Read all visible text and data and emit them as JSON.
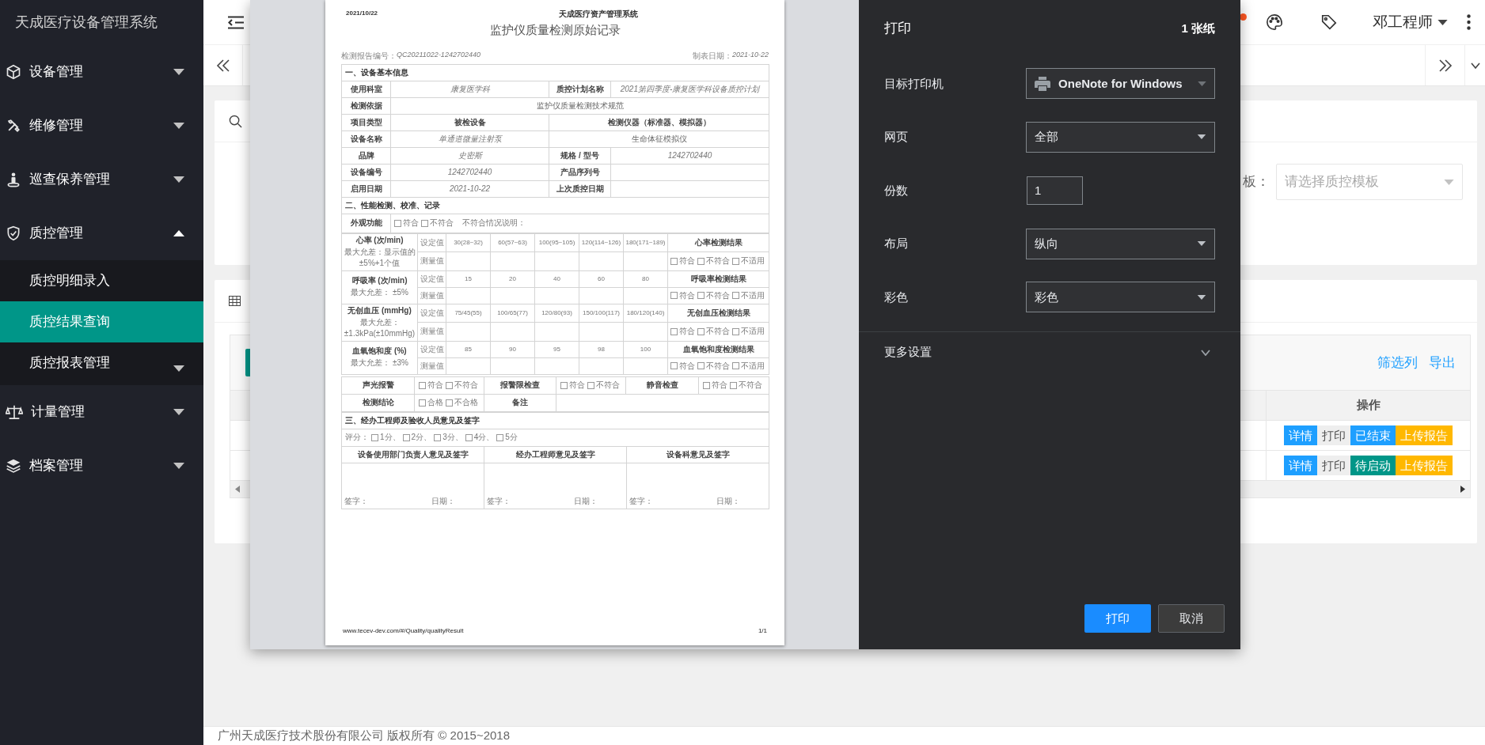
{
  "sidebar": {
    "title": "天成医疗设备管理系统",
    "items": [
      {
        "label": "设备管理",
        "expanded": false
      },
      {
        "label": "维修管理",
        "expanded": false
      },
      {
        "label": "巡查保养管理",
        "expanded": false
      },
      {
        "label": "质控管理",
        "expanded": true,
        "children": [
          {
            "label": "质控明细录入",
            "selected": false
          },
          {
            "label": "质控结果查询",
            "selected": true
          },
          {
            "label": "质控报表管理",
            "selected": false,
            "expanded": false
          }
        ]
      },
      {
        "label": "计量管理",
        "expanded": false
      },
      {
        "label": "档案管理",
        "expanded": false
      }
    ]
  },
  "header": {
    "user": "邓工程师"
  },
  "search_card": {
    "template_label": "板：",
    "template_placeholder": "请选择质控模板"
  },
  "results_table": {
    "toolbar_links": [
      "筛选列",
      "导出"
    ],
    "columns": [
      "操作"
    ],
    "rows": [
      {
        "actions": [
          {
            "label": "详情",
            "kind": "detail"
          },
          {
            "label": "打印",
            "kind": "print"
          },
          {
            "label": "已结束",
            "kind": "status",
            "color": "#1e9fff"
          },
          {
            "label": "上传报告",
            "kind": "upload"
          }
        ]
      },
      {
        "actions": [
          {
            "label": "详情",
            "kind": "detail"
          },
          {
            "label": "打印",
            "kind": "print"
          },
          {
            "label": "待启动",
            "kind": "status",
            "color": "#009688"
          },
          {
            "label": "上传报告",
            "kind": "upload"
          }
        ]
      }
    ]
  },
  "footer": "广州天成医疗技术股份有限公司 版权所有 © 2015~2018",
  "print_dialog": {
    "title": "打印",
    "sheets": "1 张纸",
    "settings": [
      {
        "label": "目标打印机",
        "kind": "printer",
        "value": "OneNote for Windows"
      },
      {
        "label": "网页",
        "kind": "select",
        "value": "全部"
      },
      {
        "label": "份数",
        "kind": "number",
        "value": "1"
      },
      {
        "label": "布局",
        "kind": "select",
        "value": "纵向"
      },
      {
        "label": "彩色",
        "kind": "select",
        "value": "彩色"
      }
    ],
    "more_settings": {
      "label": "更多设置",
      "expanded": false
    },
    "buttons": [
      {
        "label": "打印",
        "kind": "primary"
      },
      {
        "label": "取消",
        "kind": "secondary"
      }
    ],
    "document": {
      "print_date": "2021/10/22",
      "system_name": "天成医疗资产管理系统",
      "title": "监护仪质量检测原始记录",
      "report_no": {
        "label": "检测报告编号：",
        "value": "QC20211022-1242702440"
      },
      "made_date": {
        "label": "制表日期：",
        "value": "2021-10-22"
      },
      "basic_info": {
        "heading": "一、设备基本信息",
        "rows": [
          {
            "cells": [
              {
                "text": "使用科室",
                "kind": "label"
              },
              {
                "text": "康复医学科",
                "kind": "value"
              },
              {
                "text": "质控计划名称",
                "kind": "label"
              },
              {
                "text": "2021第四季度-康复医学科设备质控计划",
                "kind": "value"
              }
            ]
          },
          {
            "cells": [
              {
                "text": "检测依据",
                "kind": "label"
              },
              {
                "text": "监护仪质量检测技术规范",
                "kind": "text",
                "colspan": 3
              }
            ]
          },
          {
            "cells": [
              {
                "text": "项目类型",
                "kind": "label"
              },
              {
                "text": "被检设备",
                "kind": "header"
              },
              {
                "text": "检测仪器（标准器、模拟器）",
                "kind": "header",
                "colspan": 2
              }
            ]
          },
          {
            "cells": [
              {
                "text": "设备名称",
                "kind": "label"
              },
              {
                "text": "单通道微量注射泵",
                "kind": "value"
              },
              {
                "text": "生命体征模拟仪",
                "kind": "text",
                "colspan": 2
              }
            ]
          },
          {
            "cells": [
              {
                "text": "品牌",
                "kind": "label"
              },
              {
                "text": "史密斯",
                "kind": "value"
              },
              {
                "text": "规格 / 型号",
                "kind": "label"
              },
              {
                "text": "1242702440",
                "kind": "value"
              }
            ]
          },
          {
            "cells": [
              {
                "text": "设备编号",
                "kind": "label"
              },
              {
                "text": "1242702440",
                "kind": "value"
              },
              {
                "text": "产品序列号",
                "kind": "label"
              },
              {
                "kind": "empty"
              }
            ]
          },
          {
            "cells": [
              {
                "text": "启用日期",
                "kind": "label"
              },
              {
                "text": "2021-10-22",
                "kind": "value"
              },
              {
                "text": "上次质控日期",
                "kind": "label"
              },
              {
                "kind": "empty"
              }
            ]
          }
        ]
      },
      "performance": {
        "heading": "二、性能检测、校准、记录",
        "appearance": {
          "label": "外观功能",
          "options": [
            {
              "label": "符合",
              "checked": false
            },
            {
              "label": "不符合",
              "checked": false
            }
          ],
          "note_label": "不符合情况说明："
        },
        "groups": [
          {
            "name": "心率 (次/min)",
            "allowance": [
              "最大允差：显示值的",
              "±5%+1个值"
            ],
            "set_label": "设定值",
            "set_values": [
              "30(28~32)",
              "60(57~63)",
              "100(95~105)",
              "120(114~126)",
              "180(171~189)"
            ],
            "result_title": "心率检测结果",
            "measure_label": "测量值",
            "result_options": [
              {
                "label": "符合",
                "checked": false
              },
              {
                "label": "不符合",
                "checked": false
              },
              {
                "label": "不适用",
                "checked": false
              }
            ]
          },
          {
            "name": "呼吸率 (次/min)",
            "allowance": [
              "最大允差： ±5%"
            ],
            "set_label": "设定值",
            "set_values": [
              "15",
              "20",
              "40",
              "60",
              "80"
            ],
            "result_title": "呼吸率检测结果",
            "measure_label": "测量值",
            "result_options": [
              {
                "label": "符合",
                "checked": false
              },
              {
                "label": "不符合",
                "checked": false
              },
              {
                "label": "不适用",
                "checked": false
              }
            ]
          },
          {
            "name": "无创血压 (mmHg)",
            "allowance": [
              "最大允差：",
              "±1.3kPa(±10mmHg)"
            ],
            "set_label": "设定值",
            "set_values": [
              "75/45(55)",
              "100/65(77)",
              "120/80(93)",
              "150/100(117)",
              "180/120(140)"
            ],
            "result_title": "无创血压检测结果",
            "measure_label": "测量值",
            "result_options": [
              {
                "label": "符合",
                "checked": false
              },
              {
                "label": "不符合",
                "checked": false
              },
              {
                "label": "不适用",
                "checked": false
              }
            ]
          },
          {
            "name": "血氧饱和度 (%)",
            "allowance": [
              "最大允差： ±3%"
            ],
            "set_label": "设定值",
            "set_values": [
              "85",
              "90",
              "95",
              "98",
              "100"
            ],
            "result_title": "血氧饱和度检测结果",
            "measure_label": "测量值",
            "result_options": [
              {
                "label": "符合",
                "checked": false
              },
              {
                "label": "不符合",
                "checked": false
              },
              {
                "label": "不适用",
                "checked": false
              }
            ]
          }
        ],
        "checks": [
          {
            "label": "声光报警",
            "options": [
              {
                "label": "符合",
                "checked": false
              },
              {
                "label": "不符合",
                "checked": false
              }
            ]
          },
          {
            "label": "报警限检查",
            "options": [
              {
                "label": "符合",
                "checked": false
              },
              {
                "label": "不符合",
                "checked": false
              }
            ]
          },
          {
            "label": "静音检查",
            "options": [
              {
                "label": "符合",
                "checked": false
              },
              {
                "label": "不符合",
                "checked": false
              }
            ]
          }
        ],
        "conclusion": {
          "label": "检测结论",
          "options": [
            {
              "label": "合格",
              "checked": false
            },
            {
              "label": "不合格",
              "checked": false
            }
          ]
        },
        "remark_label": "备注"
      },
      "signoff": {
        "heading": "三、经办工程师及验收人员意见及签字",
        "rating_label": "评分：",
        "ratings": [
          {
            "label": "1分、",
            "checked": false
          },
          {
            "label": "2分、",
            "checked": false
          },
          {
            "label": "3分、",
            "checked": false
          },
          {
            "label": "4分、",
            "checked": false
          },
          {
            "label": "5分",
            "checked": false
          }
        ],
        "columns": [
          {
            "title": "设备使用部门负责人意见及签字",
            "sign_label": "签字：",
            "date_label": "日期："
          },
          {
            "title": "经办工程师意见及签字",
            "sign_label": "签字：",
            "date_label": "日期："
          },
          {
            "title": "设备科意见及签字",
            "sign_label": "签字：",
            "date_label": "日期："
          }
        ]
      },
      "footer_url": "www.tecev-dev.com/#/Quality/qualityResult",
      "page_number": "1/1"
    }
  }
}
